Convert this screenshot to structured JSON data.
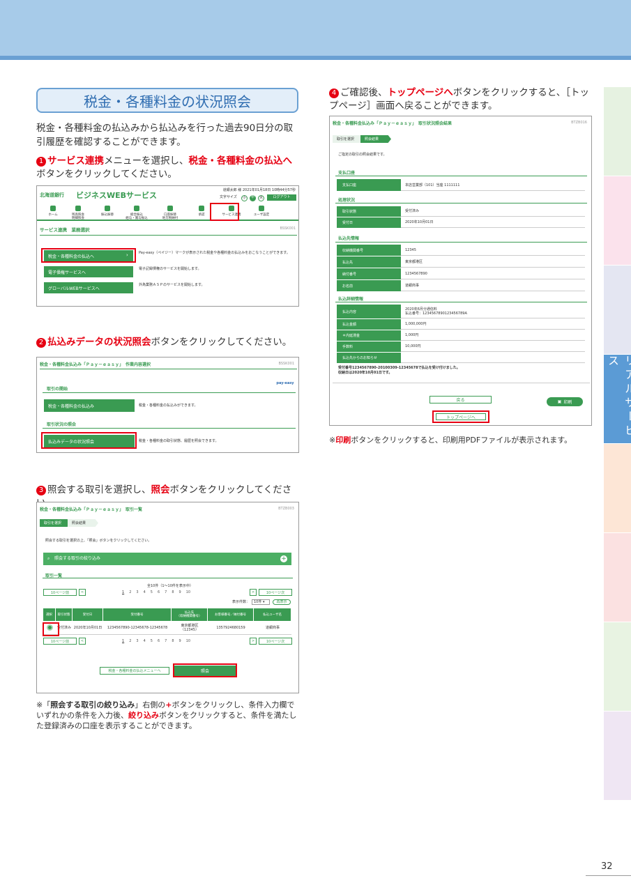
{
  "section_title": "税金・各種料金の状況照会",
  "intro": "税金・各種料金の払込みから払込みを行った過去90日分の取引履歴を確認することができます。",
  "step1": {
    "num": "1",
    "a": "サービス連携",
    "b": "メニューを選択し、",
    "c": "税金・各種料金の払込へ",
    "d": "ボタンをクリックしてください。"
  },
  "step2": {
    "num": "2",
    "a": "払込みデータの状況照会",
    "b": "ボタンをクリックしてください。"
  },
  "step3": {
    "num": "3",
    "a": "照会する取引を選択し、",
    "b": "照会",
    "c": "ボタンをクリックしてください。"
  },
  "step4": {
    "num": "4",
    "a": "ご確認後、",
    "b": "トップページへ",
    "c": "ボタンをクリックすると、［トップページ］画面へ戻ることができます。"
  },
  "note3": {
    "a": "※「",
    "b": "照会する取引の絞り込み",
    "c": "」右側の",
    "d": "+",
    "e": "ボタンをクリックし、条件入力欄でいずれかの条件を入力後、",
    "f": "絞り込み",
    "g": "ボタンをクリックすると、条件を満たした登録済みの口座を表示することができます。"
  },
  "note4": {
    "a": "※",
    "b": "印刷",
    "c": "ボタンをクリックすると、印刷用PDFファイルが表示されます。"
  },
  "side_tab": "リアルサービス",
  "page_number": "32",
  "shot1": {
    "bank": "北海道銀行",
    "service": "ビジネスWEBサービス",
    "user": "道銀太郎 様 2021年01月18日 10時44分57秒",
    "fontsize": "文字サイズ",
    "size_s": "小",
    "size_m": "中",
    "size_l": "大",
    "logout": "ログアウト",
    "nav": [
      "ホーム",
      "残高照会\n明細照会",
      "振込振替",
      "総合振込\n給与・賞与振込",
      "口座振替\n地方税納付",
      "承認",
      "サービス連携",
      "ユーザ設定"
    ],
    "title": "サービス連携　業務選択",
    "code": "BSSK001",
    "items": [
      {
        "label": "税金・各種料金の払込へ",
        "desc": "Pay-easy（ペイジー）マークが表示された税金や各種料金の払込みをおこなうことができます。"
      },
      {
        "label": "電子債権サービスへ",
        "desc": "電子記録債権のサービスを開始します。"
      },
      {
        "label": "グローバルWEBサービスへ",
        "desc": "外為業務ＡＳＰのサービスを開始します。"
      }
    ]
  },
  "shot2": {
    "title": "税金・各種料金払込み「Ｐａｙ－ｅａｓｙ」　作業内容選択",
    "code": "BSSK001",
    "logo": "pay-easy",
    "sec1": "取引の開始",
    "btn1": "税金・各種料金の払込み",
    "desc1": "税金・各種料金の払込みができます。",
    "sec2": "取引状況の照会",
    "btn2": "払込みデータの状況照会",
    "desc2": "税金・各種料金の取引状態、履歴を照会できます。"
  },
  "shot3": {
    "title": "税金・各種料金払込み「Ｐａｙ－ｅａｓｙ」　取引一覧",
    "code": "BTZB003",
    "crumb1": "取引を選択",
    "crumb2": "照会結果",
    "instr": "照会する取引を選択の上、「照会」ボタンをクリックしてください。",
    "filter": "照会する取引の絞り込み",
    "list_title": "取引一覧",
    "count": "全10件（1～10件を表示中）",
    "prev": "10ページ前",
    "next": "10ページ次",
    "pages": [
      "1",
      "2",
      "3",
      "4",
      "5",
      "6",
      "7",
      "8",
      "9",
      "10"
    ],
    "per_page": "表示件数：",
    "per_val": "10件",
    "redisplay": "再表示",
    "headers": [
      "選択",
      "取引状態",
      "受付日",
      "受付番号",
      "払込先\n（収納機関番号）",
      "お客様番号／納付番号",
      "払込ユーザ名"
    ],
    "row": [
      "受付済み",
      "2020年10月01日",
      "1234567890-12345678-12345678",
      "東京都港区\n（12345）",
      "1357924680159",
      "道銀商事"
    ],
    "back": "税金・各種料金の払込メニューへ",
    "inquire": "照会"
  },
  "shot4": {
    "title": "税金・各種料金払込み「Ｐａｙ－ｅａｓｙ」　取引状況照会結果",
    "code": "BTZB016",
    "crumb1": "取引を選択",
    "crumb2": "照会結果",
    "intro": "ご指定の取引の照会結果です。",
    "sec_account": "支払口座",
    "account_k": "支払口座",
    "account_v": "本店営業部（101）当座 1111111",
    "sec_status": "処理状況",
    "status_rows": [
      [
        "取引状態",
        "受付済み"
      ],
      [
        "受付日",
        "2020年10月01日"
      ]
    ],
    "sec_payee": "払込先情報",
    "payee_rows": [
      [
        "収納機関番号",
        "12345"
      ],
      [
        "払込先",
        "東京都港区"
      ],
      [
        "納付番号",
        "1234567890"
      ],
      [
        "お名前",
        "道銀商事"
      ]
    ],
    "sec_detail": "払込詳細情報",
    "detail_rows": [
      [
        "払込内容",
        "2020年6月分通信料\n払込番号：1234567890123456789A"
      ],
      [
        "払込金額",
        "1,000,000円"
      ],
      [
        "＊内延滞金",
        "1,000円"
      ],
      [
        "手数料",
        "10,000円"
      ],
      [
        "払込先からのお知らせ",
        ""
      ]
    ],
    "receipt": "受付番号1234567890-20100309-12345678で払込を受け付けました。\n収納日は2020年10月01日です。",
    "back": "戻る",
    "print": "印刷",
    "top": "トップページへ"
  }
}
